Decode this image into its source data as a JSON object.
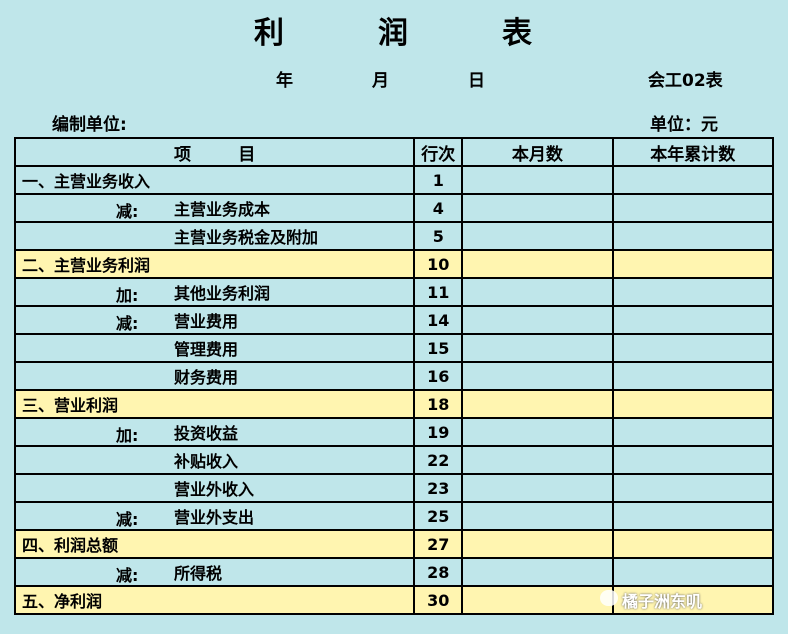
{
  "title": [
    "利",
    "润",
    "表"
  ],
  "date": {
    "year": "年",
    "month": "月",
    "day": "日",
    "form_code": "会工02表"
  },
  "org_label": "编制单位:",
  "unit_label": "单位：元",
  "headers": {
    "item": "项        目",
    "line": "行次",
    "month": "本月数",
    "year": "本年累计数"
  },
  "rows": [
    {
      "prefix": "",
      "label": "一、主营业务收入",
      "line": "1",
      "highlight": false
    },
    {
      "prefix": "减:",
      "label": "主营业务成本",
      "line": "4",
      "highlight": false
    },
    {
      "prefix": "",
      "label": "主营业务税金及附加",
      "line": "5",
      "highlight": false
    },
    {
      "prefix": "",
      "label": "二、主营业务利润",
      "line": "10",
      "highlight": true
    },
    {
      "prefix": "加:",
      "label": "其他业务利润",
      "line": "11",
      "highlight": false
    },
    {
      "prefix": "减:",
      "label": "营业费用",
      "line": "14",
      "highlight": false
    },
    {
      "prefix": "",
      "label": "管理费用",
      "line": "15",
      "highlight": false
    },
    {
      "prefix": "",
      "label": "财务费用",
      "line": "16",
      "highlight": false
    },
    {
      "prefix": "",
      "label": "三、营业利润",
      "line": "18",
      "highlight": true
    },
    {
      "prefix": "加:",
      "label": "投资收益",
      "line": "19",
      "highlight": false
    },
    {
      "prefix": "",
      "label": "补贴收入",
      "line": "22",
      "highlight": false
    },
    {
      "prefix": "",
      "label": "营业外收入",
      "line": "23",
      "highlight": false
    },
    {
      "prefix": "减:",
      "label": "营业外支出",
      "line": "25",
      "highlight": false
    },
    {
      "prefix": "",
      "label": "四、利润总额",
      "line": "27",
      "highlight": true
    },
    {
      "prefix": "减:",
      "label": "所得税",
      "line": "28",
      "highlight": false
    },
    {
      "prefix": "",
      "label": "五、净利润",
      "line": "30",
      "highlight": true
    }
  ],
  "watermark": "橘子洲东叽",
  "colors": {
    "background": "#bfe6ea",
    "highlight": "#fff5b0"
  }
}
